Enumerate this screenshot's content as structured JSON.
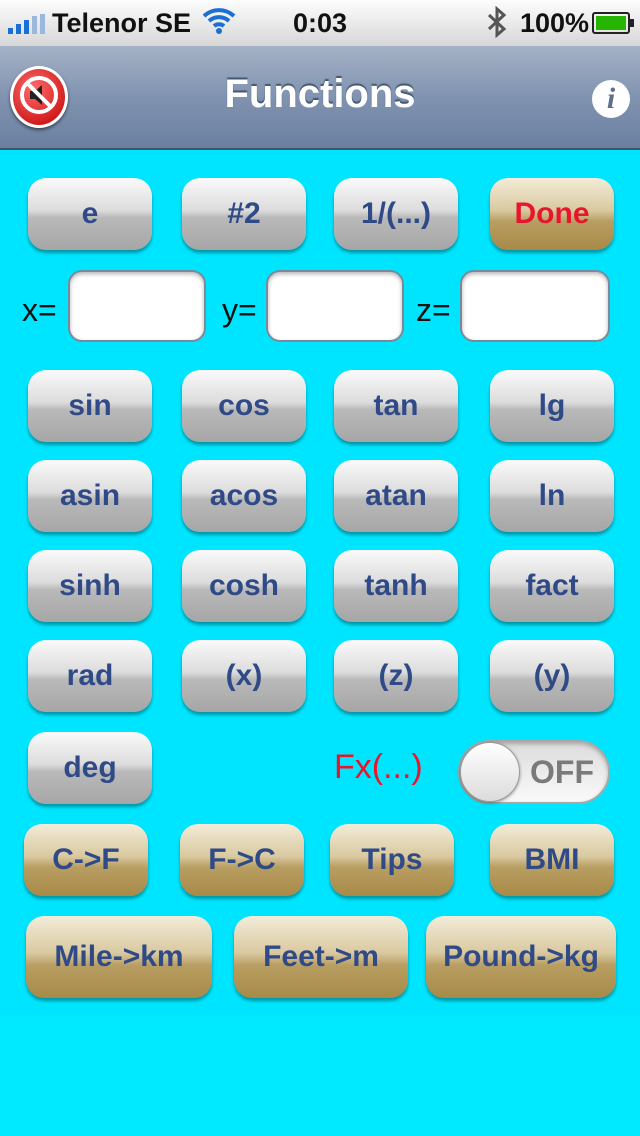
{
  "status_bar": {
    "carrier": "Telenor SE",
    "time": "0:03",
    "battery": "100%"
  },
  "nav": {
    "title": "Functions"
  },
  "row1": [
    "e",
    "#2",
    "1/(...)",
    "Done"
  ],
  "inputs": {
    "x_label": "x=",
    "y_label": "y=",
    "z_label": "z=",
    "x_value": "",
    "y_value": "",
    "z_value": ""
  },
  "trig": [
    "sin",
    "cos",
    "tan",
    "lg"
  ],
  "arc": [
    "asin",
    "acos",
    "atan",
    "ln"
  ],
  "hyp": [
    "sinh",
    "cosh",
    "tanh",
    "fact"
  ],
  "vars": [
    "rad",
    "(x)",
    "(z)",
    "(y)"
  ],
  "deg_label": "deg",
  "fx_label": "Fx(...)",
  "toggle_state": "OFF",
  "conversions1": [
    "C->F",
    "F->C",
    "Tips",
    "BMI"
  ],
  "conversions2": [
    "Mile->km",
    "Feet->m",
    "Pound->kg"
  ],
  "colors": {
    "background": "#00e5ff",
    "button_text": "#2f4a87",
    "done_text": "#e8162c",
    "fx_text": "#e8162c"
  },
  "icons": {
    "mute": "speaker-muted-icon",
    "info": "info-icon",
    "wifi": "wifi-icon",
    "bluetooth": "bluetooth-icon"
  }
}
